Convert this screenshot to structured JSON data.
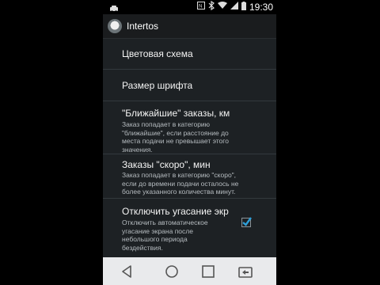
{
  "status_bar": {
    "time": "19:30",
    "icons": [
      "taxi-icon",
      "nfc-icon",
      "bluetooth-icon",
      "wifi-icon",
      "signal-icon",
      "battery-icon"
    ]
  },
  "action_bar": {
    "title": "Intertos",
    "icon": "app-logo-icon"
  },
  "settings": [
    {
      "title": "Цветовая схема"
    },
    {
      "title": "Размер шрифта"
    },
    {
      "title": "\"Ближайшие\" заказы, км",
      "summary": [
        "Заказ попадает в категорию",
        "\"ближайшие\", если расстояние до",
        "места подачи не превышает этого",
        "значения."
      ]
    },
    {
      "title": "Заказы \"скоро\", мин",
      "summary": [
        "Заказ попадает в категорию \"скоро\",",
        "если до времени подачи осталось не",
        "более указанного количества минут."
      ]
    },
    {
      "title": "Отключить угасание экр",
      "summary": [
        "Отключить автоматическое",
        "угасание экрана после",
        "небольшого периода",
        "бездействия."
      ],
      "checked": true
    }
  ],
  "nav_bar": {
    "buttons": [
      "back-icon",
      "home-icon",
      "recents-icon",
      "screen-switch-icon"
    ]
  },
  "colors": {
    "accent": "#2f9fd8",
    "background": "#1d2124",
    "navbar": "#e9eaec"
  }
}
